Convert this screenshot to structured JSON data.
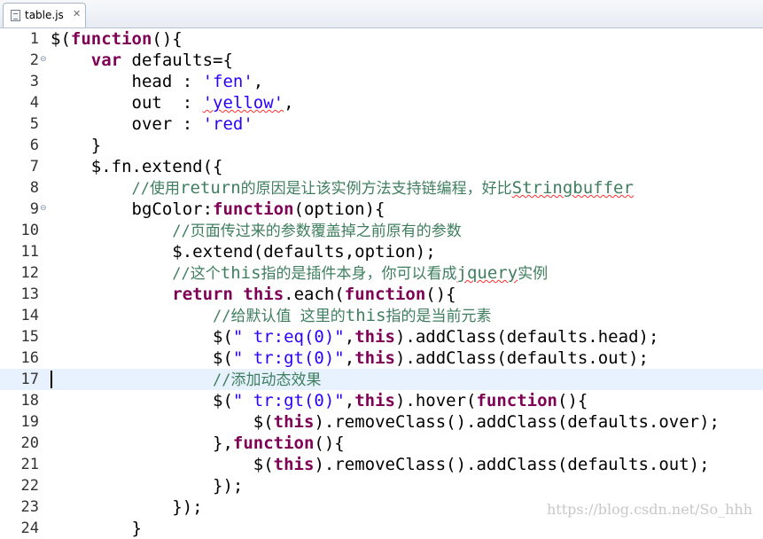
{
  "tab": {
    "label": "table.js",
    "close": "✕",
    "icon": "js-file-icon"
  },
  "editor": {
    "lines": [
      {
        "n": "1",
        "segs": [
          [
            "p",
            "$("
          ],
          [
            "kw",
            "function"
          ],
          [
            "p",
            "(){"
          ]
        ]
      },
      {
        "n": "2",
        "fold": true,
        "segs": [
          [
            "p",
            "    "
          ],
          [
            "kw",
            "var"
          ],
          [
            "p",
            " defaults={"
          ]
        ]
      },
      {
        "n": "3",
        "segs": [
          [
            "p",
            "        head : "
          ],
          [
            "str",
            "'fen'"
          ],
          [
            "p",
            ","
          ]
        ]
      },
      {
        "n": "4",
        "segs": [
          [
            "p",
            "        out  : "
          ],
          [
            "str",
            "'yellow'"
          ],
          [
            "p",
            ","
          ]
        ]
      },
      {
        "n": "5",
        "segs": [
          [
            "p",
            "        over : "
          ],
          [
            "str",
            "'red'"
          ]
        ]
      },
      {
        "n": "6",
        "segs": [
          [
            "p",
            "    }"
          ]
        ]
      },
      {
        "n": "7",
        "segs": [
          [
            "p",
            "    $.fn.extend({"
          ]
        ]
      },
      {
        "n": "8",
        "segs": [
          [
            "p",
            "        "
          ],
          [
            "cm",
            "//使用"
          ],
          [
            "cme",
            "return"
          ],
          [
            "cm",
            "的原因是让该实例方法支持链编程，好比"
          ],
          [
            "cme",
            "Stringbuffer"
          ]
        ]
      },
      {
        "n": "9",
        "fold": true,
        "segs": [
          [
            "p",
            "        bgColor:"
          ],
          [
            "kw",
            "function"
          ],
          [
            "p",
            "(option){"
          ]
        ]
      },
      {
        "n": "10",
        "segs": [
          [
            "p",
            "            "
          ],
          [
            "cm",
            "//页面传过来的参数覆盖掉之前原有的参数"
          ]
        ]
      },
      {
        "n": "11",
        "segs": [
          [
            "p",
            "            $.extend(defaults,option);"
          ]
        ]
      },
      {
        "n": "12",
        "segs": [
          [
            "p",
            "            "
          ],
          [
            "cm",
            "//这个"
          ],
          [
            "cme",
            "this"
          ],
          [
            "cm",
            "指的是插件本身，你可以看成"
          ],
          [
            "cme",
            "jquery"
          ],
          [
            "cm",
            "实例"
          ]
        ]
      },
      {
        "n": "13",
        "segs": [
          [
            "p",
            "            "
          ],
          [
            "kw",
            "return"
          ],
          [
            "p",
            " "
          ],
          [
            "kw",
            "this"
          ],
          [
            "p",
            ".each("
          ],
          [
            "kw",
            "function"
          ],
          [
            "p",
            "(){"
          ]
        ]
      },
      {
        "n": "14",
        "segs": [
          [
            "p",
            "                "
          ],
          [
            "cm",
            "//给默认值 这里的"
          ],
          [
            "cme",
            "this"
          ],
          [
            "cm",
            "指的是当前元素"
          ]
        ]
      },
      {
        "n": "15",
        "segs": [
          [
            "p",
            "                $("
          ],
          [
            "str",
            "\" tr:eq(0)\""
          ],
          [
            "p",
            ","
          ],
          [
            "kw",
            "this"
          ],
          [
            "p",
            ").addClass(defaults.head);"
          ]
        ]
      },
      {
        "n": "16",
        "segs": [
          [
            "p",
            "                $("
          ],
          [
            "str",
            "\" tr:gt(0)\""
          ],
          [
            "p",
            ","
          ],
          [
            "kw",
            "this"
          ],
          [
            "p",
            ").addClass(defaults.out);"
          ]
        ]
      },
      {
        "n": "17",
        "current": true,
        "segs": [
          [
            "p",
            "                "
          ],
          [
            "cm",
            "//添加动态效果"
          ]
        ]
      },
      {
        "n": "18",
        "segs": [
          [
            "p",
            "                $("
          ],
          [
            "str",
            "\" tr:gt(0)\""
          ],
          [
            "p",
            ","
          ],
          [
            "kw",
            "this"
          ],
          [
            "p",
            ").hover("
          ],
          [
            "kw",
            "function"
          ],
          [
            "p",
            "(){"
          ]
        ]
      },
      {
        "n": "19",
        "segs": [
          [
            "p",
            "                    $("
          ],
          [
            "kw",
            "this"
          ],
          [
            "p",
            ").removeClass().addClass(defaults.over);"
          ]
        ]
      },
      {
        "n": "20",
        "segs": [
          [
            "p",
            "                },"
          ],
          [
            "kw",
            "function"
          ],
          [
            "p",
            "(){"
          ]
        ]
      },
      {
        "n": "21",
        "segs": [
          [
            "p",
            "                    $("
          ],
          [
            "kw",
            "this"
          ],
          [
            "p",
            ").removeClass().addClass(defaults.out);"
          ]
        ]
      },
      {
        "n": "22",
        "segs": [
          [
            "p",
            "                });"
          ]
        ]
      },
      {
        "n": "23",
        "segs": [
          [
            "p",
            "            });"
          ]
        ]
      },
      {
        "n": "24",
        "segs": [
          [
            "p",
            "        }"
          ]
        ]
      }
    ]
  },
  "watermark": "https://blog.csdn.net/So_hhh",
  "colors": {
    "keyword": "#7f0055",
    "string": "#2a00ff",
    "comment": "#3f7f5f",
    "current_line": "#e8f2fe"
  }
}
